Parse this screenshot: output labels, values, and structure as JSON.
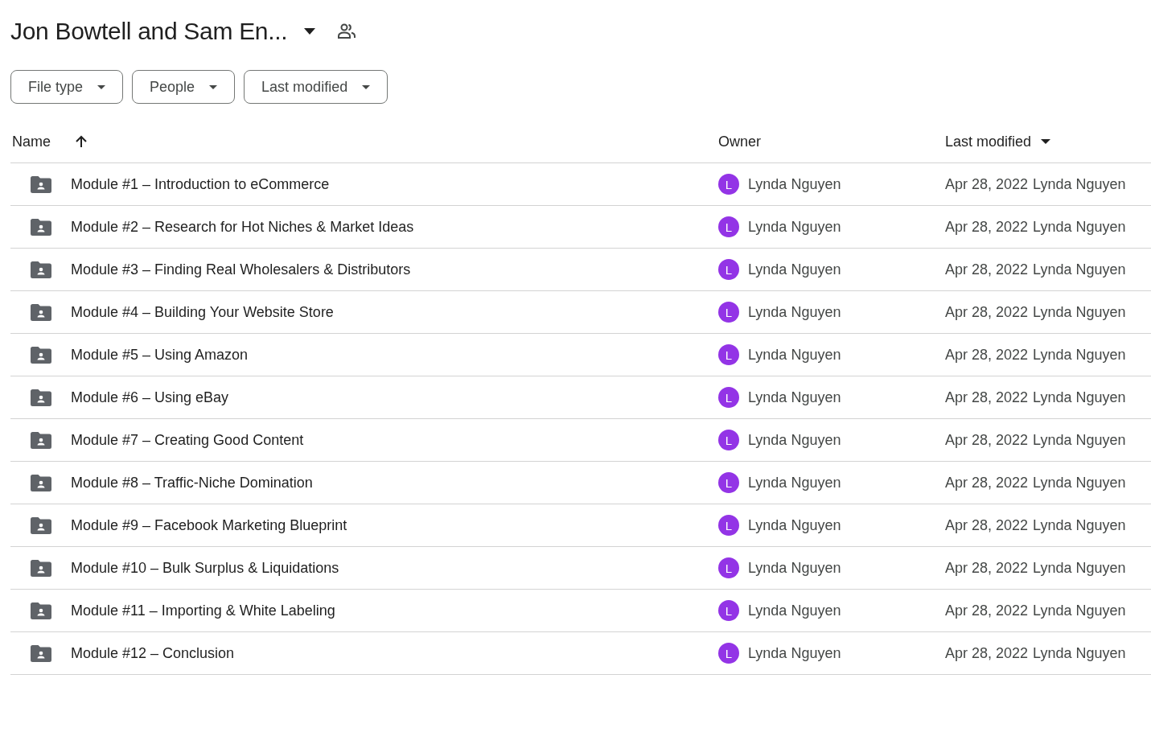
{
  "title": "Jon Bowtell and Sam En...",
  "filters": [
    "File type",
    "People",
    "Last modified"
  ],
  "columns": {
    "name": "Name",
    "owner": "Owner",
    "modified": "Last modified"
  },
  "rows": [
    {
      "name": "Module #1 – Introduction to eCommerce",
      "avatar": "L",
      "owner": "Lynda Nguyen",
      "modified": "Apr 28, 2022",
      "modified_by": "Lynda Nguyen"
    },
    {
      "name": "Module #2 – Research for Hot Niches & Market Ideas",
      "avatar": "L",
      "owner": "Lynda Nguyen",
      "modified": "Apr 28, 2022",
      "modified_by": "Lynda Nguyen"
    },
    {
      "name": "Module #3 – Finding Real Wholesalers & Distributors",
      "avatar": "L",
      "owner": "Lynda Nguyen",
      "modified": "Apr 28, 2022",
      "modified_by": "Lynda Nguyen"
    },
    {
      "name": "Module #4 – Building Your Website Store",
      "avatar": "L",
      "owner": "Lynda Nguyen",
      "modified": "Apr 28, 2022",
      "modified_by": "Lynda Nguyen"
    },
    {
      "name": "Module #5 – Using Amazon",
      "avatar": "L",
      "owner": "Lynda Nguyen",
      "modified": "Apr 28, 2022",
      "modified_by": "Lynda Nguyen"
    },
    {
      "name": "Module #6 – Using eBay",
      "avatar": "L",
      "owner": "Lynda Nguyen",
      "modified": "Apr 28, 2022",
      "modified_by": "Lynda Nguyen"
    },
    {
      "name": "Module #7 – Creating Good Content",
      "avatar": "L",
      "owner": "Lynda Nguyen",
      "modified": "Apr 28, 2022",
      "modified_by": "Lynda Nguyen"
    },
    {
      "name": "Module #8 – Traffic-Niche Domination",
      "avatar": "L",
      "owner": "Lynda Nguyen",
      "modified": "Apr 28, 2022",
      "modified_by": "Lynda Nguyen"
    },
    {
      "name": "Module #9 – Facebook Marketing Blueprint",
      "avatar": "L",
      "owner": "Lynda Nguyen",
      "modified": "Apr 28, 2022",
      "modified_by": "Lynda Nguyen"
    },
    {
      "name": "Module #10 – Bulk Surplus & Liquidations",
      "avatar": "L",
      "owner": "Lynda Nguyen",
      "modified": "Apr 28, 2022",
      "modified_by": "Lynda Nguyen"
    },
    {
      "name": "Module #11 – Importing & White Labeling",
      "avatar": "L",
      "owner": "Lynda Nguyen",
      "modified": "Apr 28, 2022",
      "modified_by": "Lynda Nguyen"
    },
    {
      "name": "Module #12 – Conclusion",
      "avatar": "L",
      "owner": "Lynda Nguyen",
      "modified": "Apr 28, 2022",
      "modified_by": "Lynda Nguyen"
    }
  ]
}
